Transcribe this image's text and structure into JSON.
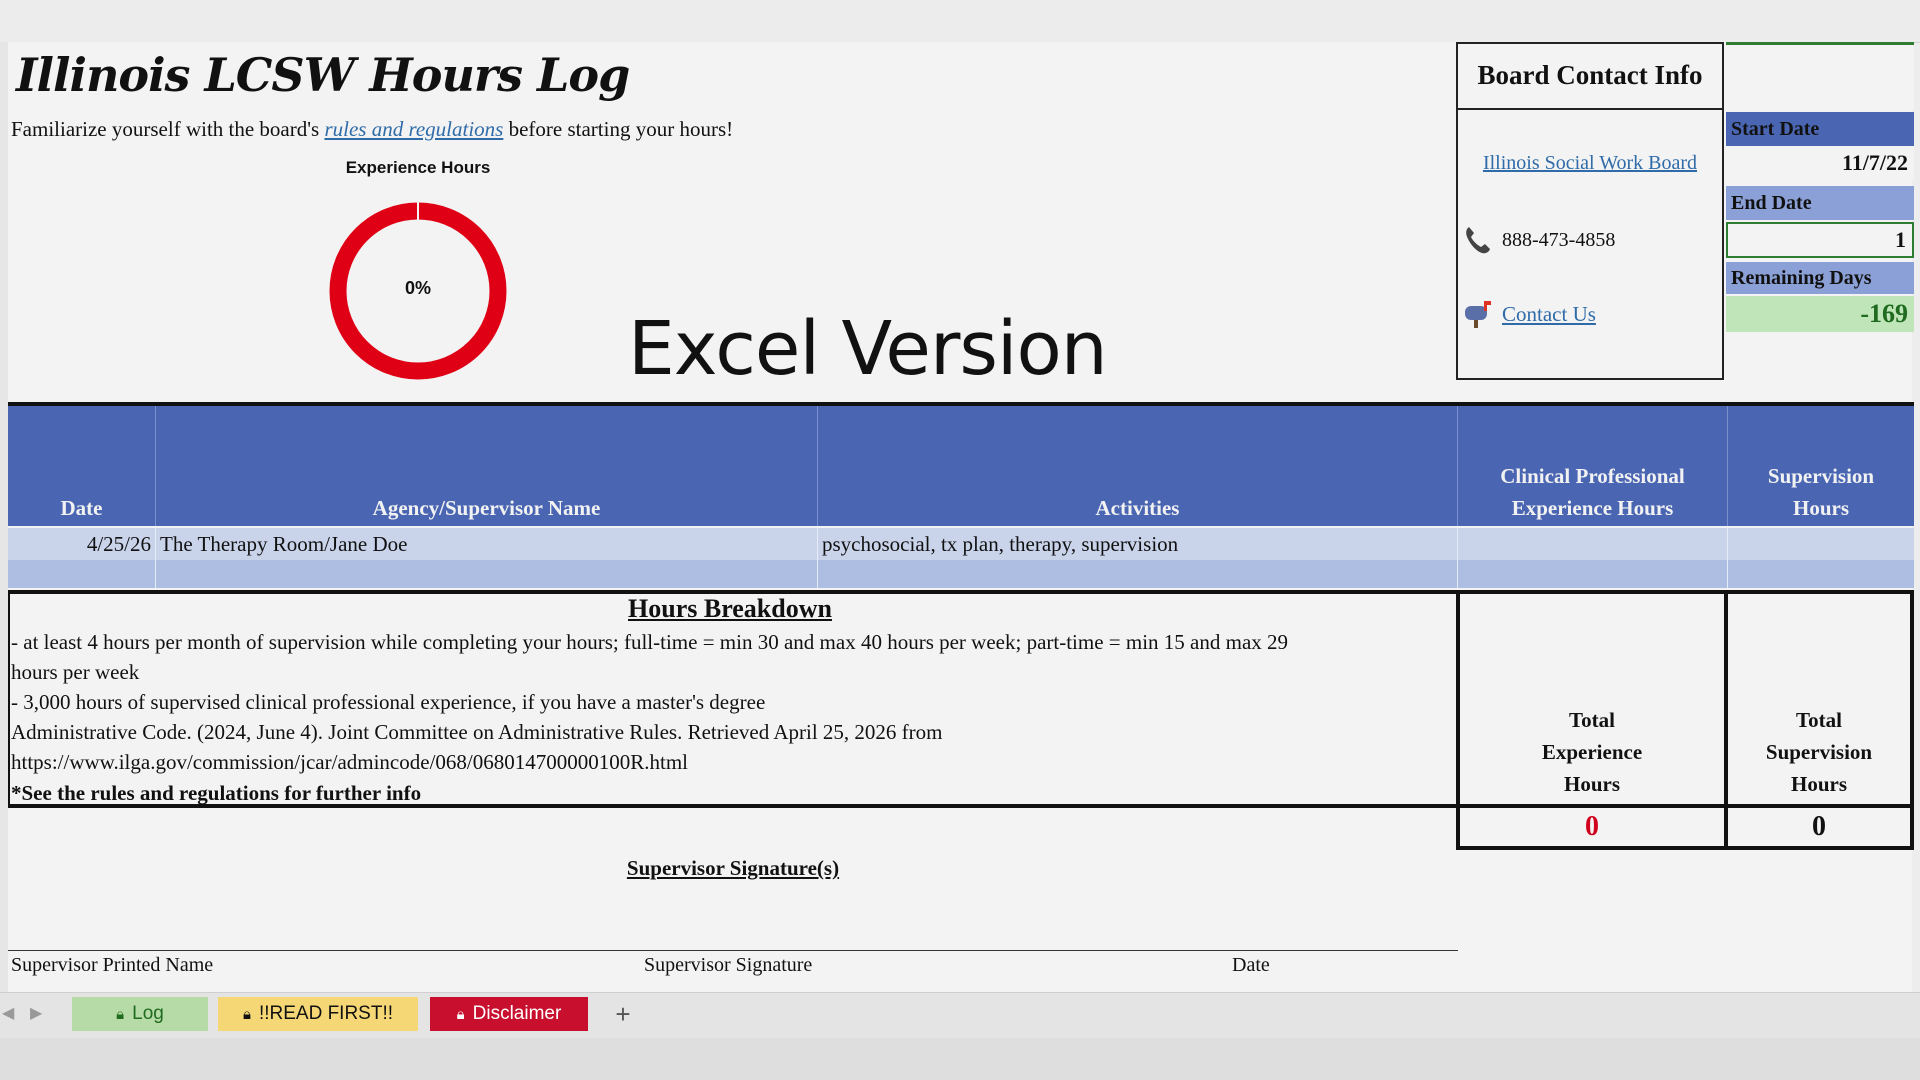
{
  "title": "Illinois LCSW Hours Log",
  "intro": {
    "before": "Familiarize yourself with the board's ",
    "link": "rules and regulations",
    "after": " before starting your hours!"
  },
  "donut": {
    "title": "Experience Hours",
    "label": "0%",
    "progress": 0,
    "color": "#e00016"
  },
  "overlay_text": "Excel Version",
  "board": {
    "heading": "Board Contact Info",
    "link": "Illinois Social Work Board",
    "phone": "888-473-4858",
    "contact": "Contact Us",
    "icons": [
      "phone-icon",
      "mailbox-icon"
    ]
  },
  "dates": {
    "start_label": "Start Date",
    "start_value": "11/7/22",
    "end_label": "End Date",
    "end_value": "1",
    "remaining_label": "Remaining Days",
    "remaining_value": "-169"
  },
  "table": {
    "headers": [
      "Date",
      "Agency/Supervisor Name",
      "Activities",
      "Clinical Professional Experience Hours",
      "Supervision Hours"
    ],
    "rows": [
      {
        "date": "4/25/26",
        "agency": "The Therapy Room/Jane Doe",
        "activities": "psychosocial, tx plan, therapy, supervision",
        "clinical": "",
        "supervision": ""
      }
    ]
  },
  "breakdown": {
    "title": "Hours Breakdown",
    "line1": "- at least 4 hours per month of supervision while completing your hours; full-time = min 30 and max 40 hours per week; part-time = min 15 and max 29",
    "line1b": "hours per week",
    "line2": "- 3,000 hours of supervised clinical professional experience, if you have a master's degree",
    "line3": "Administrative Code. (2024, June 4). Joint Committee on Administrative Rules. Retrieved April 25, 2026 from",
    "line4": "https://www.ilga.gov/commission/jcar/admincode/068/068014700000100R.html",
    "line5": "*See the rules and regulations for further info"
  },
  "totals": {
    "experience_label": "Total Experience Hours",
    "experience_value": "0",
    "supervision_label": "Total Supervision Hours",
    "supervision_value": "0"
  },
  "signature": {
    "title": "Supervisor Signature(s)",
    "printed": "Supervisor Printed Name",
    "signature": "Supervisor Signature",
    "date": "Date"
  },
  "tabs": [
    {
      "label": "Log",
      "bg": "#b6dba6",
      "fg": "#1f6b1f"
    },
    {
      "label": "!!READ FIRST!!",
      "bg": "#f5d776",
      "fg": "#111111"
    },
    {
      "label": "Disclaimer",
      "bg": "#c8102e",
      "fg": "#ffffff"
    }
  ],
  "add_tab": "+"
}
